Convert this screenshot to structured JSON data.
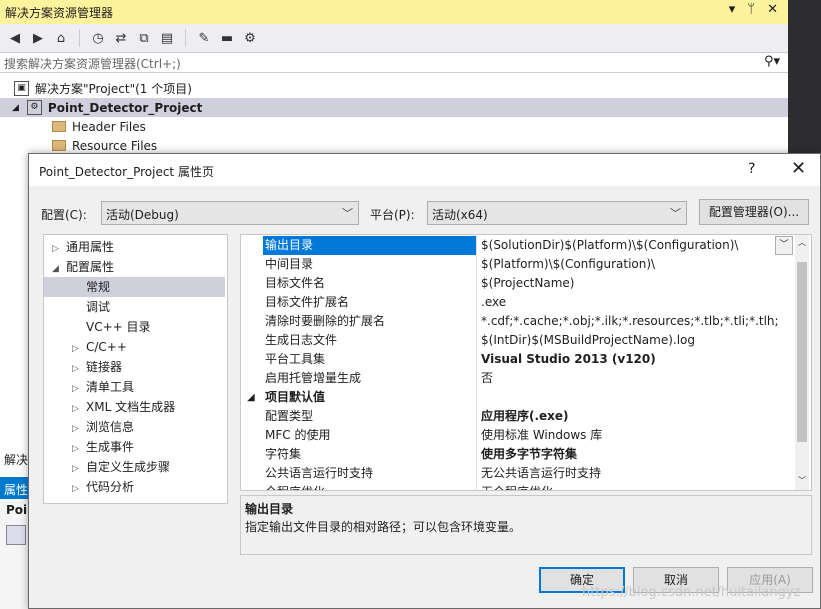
{
  "solution_explorer": {
    "title": "解决方案资源管理器",
    "title_buttons": [
      "▾",
      "ᛘ",
      "✕"
    ],
    "search_placeholder": "搜索解决方案资源管理器(Ctrl+;)",
    "search_icon": "search-icon",
    "tree": {
      "solution": "解决方案\"Project\"(1 个项目)",
      "project": "Point_Detector_Project",
      "folders": [
        "Header Files",
        "Resource Files"
      ]
    },
    "bottom_label": "解决",
    "properties_panel_title": "属性",
    "properties_panel_item": "Poi"
  },
  "dialog": {
    "title": "Point_Detector_Project 属性页",
    "help": "?",
    "close": "✕",
    "config_label": "配置(C):",
    "config_value": "活动(Debug)",
    "platform_label": "平台(P):",
    "platform_value": "活动(x64)",
    "config_manager": "配置管理器(O)...",
    "nav": [
      {
        "label": "通用属性",
        "arrow": "▷",
        "level": 0
      },
      {
        "label": "配置属性",
        "arrow": "◢",
        "level": 0
      },
      {
        "label": "常规",
        "arrow": "",
        "level": 1,
        "selected": true
      },
      {
        "label": "调试",
        "arrow": "",
        "level": 1
      },
      {
        "label": "VC++ 目录",
        "arrow": "",
        "level": 1
      },
      {
        "label": "C/C++",
        "arrow": "▷",
        "level": 1
      },
      {
        "label": "链接器",
        "arrow": "▷",
        "level": 1
      },
      {
        "label": "清单工具",
        "arrow": "▷",
        "level": 1
      },
      {
        "label": "XML 文档生成器",
        "arrow": "▷",
        "level": 1
      },
      {
        "label": "浏览信息",
        "arrow": "▷",
        "level": 1
      },
      {
        "label": "生成事件",
        "arrow": "▷",
        "level": 1
      },
      {
        "label": "自定义生成步骤",
        "arrow": "▷",
        "level": 1
      },
      {
        "label": "代码分析",
        "arrow": "▷",
        "level": 1
      }
    ],
    "grid": [
      {
        "name": "输出目录",
        "value": "$(SolutionDir)$(Platform)\\$(Configuration)\\",
        "selected": true
      },
      {
        "name": "中间目录",
        "value": "$(Platform)\\$(Configuration)\\"
      },
      {
        "name": "目标文件名",
        "value": "$(ProjectName)"
      },
      {
        "name": "目标文件扩展名",
        "value": ".exe"
      },
      {
        "name": "清除时要删除的扩展名",
        "value": "*.cdf;*.cache;*.obj;*.ilk;*.resources;*.tlb;*.tli;*.tlh;*.tmp;*.rsp"
      },
      {
        "name": "生成日志文件",
        "value": "$(IntDir)$(MSBuildProjectName).log"
      },
      {
        "name": "平台工具集",
        "value": "Visual Studio 2013 (v120)",
        "bold": true
      },
      {
        "name": "启用托管增量生成",
        "value": "否"
      },
      {
        "name": "项目默认值",
        "value": "",
        "category": true
      },
      {
        "name": "配置类型",
        "value": "应用程序(.exe)",
        "bold": true
      },
      {
        "name": "MFC 的使用",
        "value": "使用标准 Windows 库"
      },
      {
        "name": "字符集",
        "value": "使用多字节字符集",
        "bold": true
      },
      {
        "name": "公共语言运行时支持",
        "value": "无公共语言运行时支持"
      },
      {
        "name": "全程序优化",
        "value": "无全程序优化"
      }
    ],
    "description": {
      "heading": "输出目录",
      "body": "指定输出文件目录的相对路径；可以包含环境变量。"
    },
    "buttons": {
      "ok": "确定",
      "cancel": "取消",
      "apply": "应用(A)"
    }
  },
  "watermark": "https://blog.csdn.net/huitailangyz"
}
